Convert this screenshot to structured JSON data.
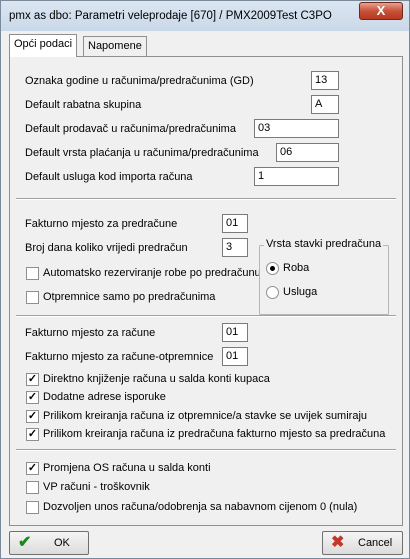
{
  "window": {
    "title": "pmx as dbo: Parametri veleprodaje [670] / PMX2009Test C3PO",
    "close_glyph": "X"
  },
  "tabs": [
    {
      "label": "Opći podaci",
      "active": true
    },
    {
      "label": "Napomene",
      "active": false
    }
  ],
  "section1": {
    "fields": [
      {
        "label": "Oznaka godine u računima/predračunima (GD)",
        "value": "13"
      },
      {
        "label": "Default rabatna skupina",
        "value": "A"
      },
      {
        "label": "Default prodavač u računima/predračunima",
        "value": "03"
      },
      {
        "label": "Default vrsta plaćanja u računima/predračunima",
        "value": "06"
      },
      {
        "label": "Default usluga kod importa računa",
        "value": "1"
      }
    ]
  },
  "section2": {
    "fakturno_label": "Fakturno mjesto za predračune",
    "fakturno_value": "01",
    "broj_dana_label": "Broj dana koliko vrijedi predračun",
    "broj_dana_value": "3",
    "checkboxes": [
      {
        "label": "Automatsko rezerviranje robe po predračunu",
        "checked": false
      },
      {
        "label": "Otpremnice samo po predračunima",
        "checked": false
      }
    ],
    "group_title": "Vrsta stavki predračuna",
    "radios": [
      {
        "label": "Roba",
        "selected": true
      },
      {
        "label": "Usluga",
        "selected": false
      }
    ]
  },
  "section3": {
    "fakturno_racune_label": "Fakturno mjesto za račune",
    "fakturno_racune_value": "01",
    "fakturno_otpremnice_label": "Fakturno mjesto za račune-otpremnice",
    "fakturno_otpremnice_value": "01",
    "checkboxes": [
      {
        "label": "Direktno knjiženje računa u salda konti kupaca",
        "checked": true
      },
      {
        "label": "Dodatne adrese isporuke",
        "checked": true
      },
      {
        "label": "Prilikom kreiranja računa iz otpremnice/a stavke se uvijek sumiraju",
        "checked": true
      },
      {
        "label": "Prilikom kreiranja računa iz predračuna fakturno mjesto sa predračuna",
        "checked": true
      }
    ]
  },
  "section4": {
    "checkboxes": [
      {
        "label": "Promjena OS računa u salda konti",
        "checked": true
      },
      {
        "label": "VP računi - troškovnik",
        "checked": false
      },
      {
        "label": "Dozvoljen unos računa/odobrenja sa nabavnom cijenom 0 (nula)",
        "checked": false
      }
    ]
  },
  "buttons": {
    "ok_label": "OK",
    "ok_icon": "checkmark-icon",
    "ok_color": "#1a8a1a",
    "cancel_label": "Cancel",
    "cancel_icon": "x-icon",
    "cancel_color": "#c0392b"
  }
}
